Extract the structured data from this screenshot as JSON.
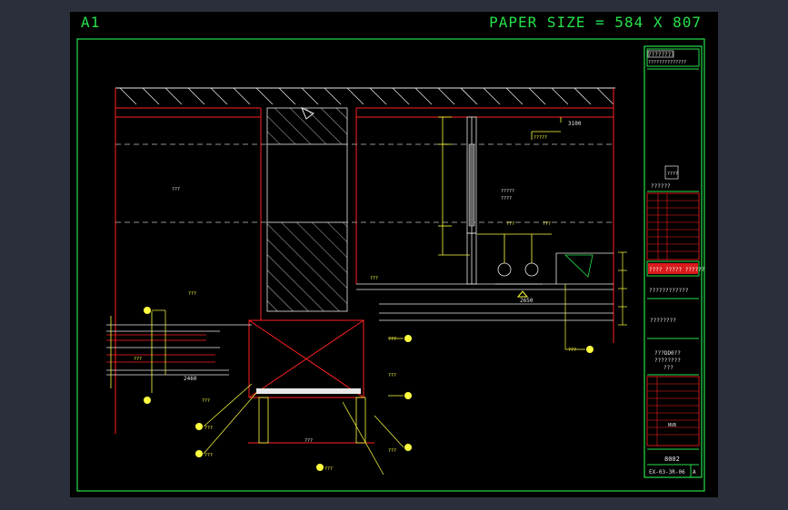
{
  "sheet": {
    "size_label": "A1",
    "paper_label": "PAPER SIZE = 584 X 807"
  },
  "colors": {
    "background": "#2b2e3b",
    "sheet": "#000000",
    "border": "#25e04a",
    "red": "#ff2020",
    "yellow": "#ffff40",
    "white": "#e8e8e8",
    "dim_gray": "#c0c0c0"
  },
  "drawing": {
    "dims": {
      "top_right": "3100",
      "mid": "2650",
      "left_lower": "2460",
      "left_mark": "???",
      "center_top": "???"
    },
    "labels": {
      "room": "???",
      "bottom_center": "???",
      "a": "?????",
      "b": "?????",
      "c": "????",
      "d": "???",
      "e": "???",
      "f": "???",
      "g": "???",
      "h": "???",
      "i": "???",
      "j": "???",
      "k": "???",
      "l": "???",
      "m": "???",
      "n": "???"
    }
  },
  "title_block": {
    "header_line1": "????????",
    "header_line2": "??????????????",
    "logo_text": "????",
    "stamp_text": "??????",
    "company": "???? ????? ??????",
    "sub_company": "????????????",
    "drawing_name": "????????",
    "desc1": "???DD0??",
    "desc2": "????????",
    "desc3": "???",
    "scale_value": "NVB",
    "date": "8002",
    "drawing_no": "EX-03-3R-06",
    "revision": "A"
  }
}
